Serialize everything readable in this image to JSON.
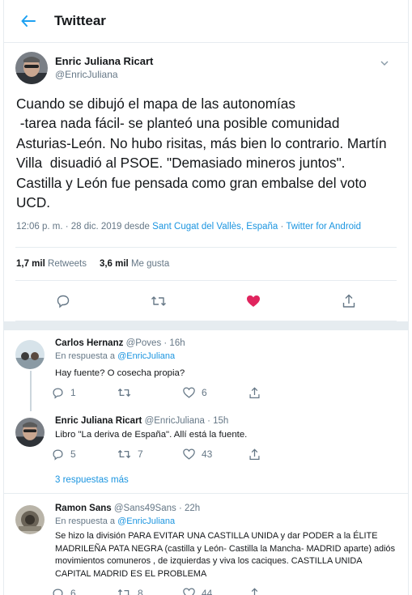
{
  "header": {
    "title": "Twittear"
  },
  "main_tweet": {
    "display_name": "Enric Juliana Ricart",
    "handle": "@EnricJuliana",
    "text": "Cuando se dibujó el mapa de las autonomías\n -tarea nada fácil- se planteó una posible comunidad Asturias-León. No hubo risitas, más bien lo contrario. Martín Villa  disuadió al PSOE. \"Demasiado mineros juntos\".\nCastilla y León fue pensada como gran embalse del voto UCD.",
    "time": "12:06 p. m. · 28 dic. 2019",
    "desde": " desde ",
    "location": "Sant Cugat del Vallès, España",
    "sep": " · ",
    "source": "Twitter for Android",
    "retweets_count": "1,7 mil",
    "retweets_label": "Retweets",
    "likes_count": "3,6 mil",
    "likes_label": "Me gusta"
  },
  "replies": [
    {
      "display_name": "Carlos Hernanz",
      "meta": "@Poves · 16h",
      "reply_prefix": "En respuesta a ",
      "reply_to": "@EnricJuliana",
      "text": "Hay fuente? O cosecha propia?",
      "replies": "1",
      "retweets": "",
      "likes": "6"
    },
    {
      "display_name": "Enric Juliana Ricart",
      "meta": "@EnricJuliana · 15h",
      "text": "Libro \"La deriva de España\". Allí está la fuente.",
      "replies": "5",
      "retweets": "7",
      "likes": "43"
    },
    {
      "display_name": "Ramon Sans",
      "meta": "@Sans49Sans · 22h",
      "reply_prefix": "En respuesta a ",
      "reply_to": "@EnricJuliana",
      "text": "Se hizo la división PARA EVITAR UNA CASTILLA UNIDA y dar PODER  a la ÉLITE MADRILEÑA PATA NEGRA (castilla y León- Castilla la Mancha- MADRID aparte) adiós movimientos comuneros , de izquierdas y viva los caciques. CASTILLA UNIDA CAPITAL MADRID ES EL PROBLEMA",
      "replies": "6",
      "retweets": "8",
      "likes": "44"
    }
  ],
  "show_more": "3 respuestas más",
  "colors": {
    "accent": "#1da1f2",
    "like_active": "#e0245e",
    "muted": "#657786",
    "border": "#e6ecf0"
  }
}
